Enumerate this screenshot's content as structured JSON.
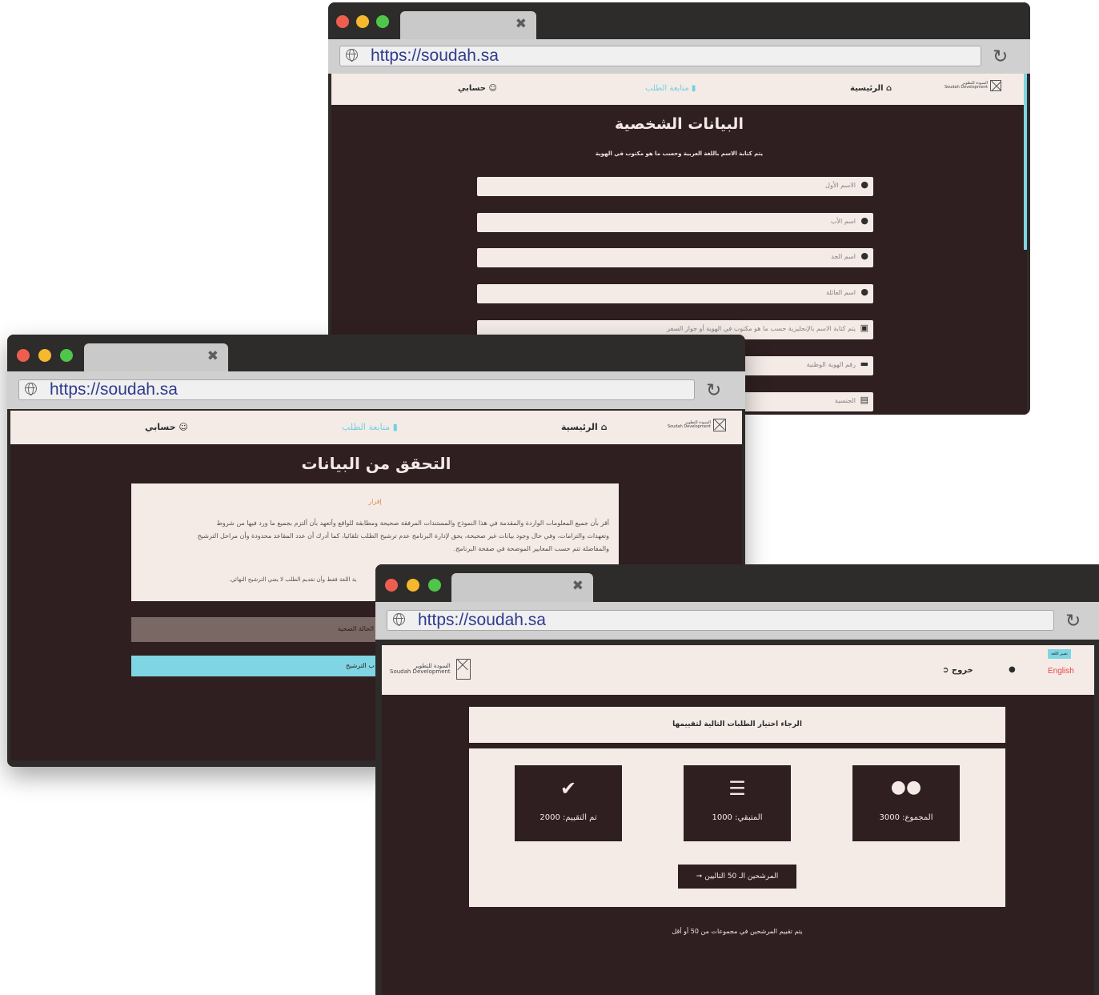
{
  "browser": {
    "url": "https://soudah.sa",
    "tab_close_icon": "✖",
    "reload_icon": "↻"
  },
  "logo": {
    "ar": "السودة للتطوير",
    "en": "Soudah Development"
  },
  "nav": {
    "home": "الرئيسية",
    "track": "متابعة الطلب",
    "account": "حسابي"
  },
  "win1": {
    "title": "البيانات الشخصية",
    "subtitle": "يتم كتابة الاسم باللغة العربية وحسب ما هو مكتوب في الهوية",
    "fields": {
      "first_name": "الاسم الأول",
      "father_name": "اسم الأب",
      "grandfather_name": "اسم الجد",
      "family_name": "اسم العائلة",
      "english_name": "يتم كتابة الاسم بالإنجليزية حسب ما هو مكتوب في الهوية أو جواز السفر",
      "national_id": "رقم الهوية الوطنية",
      "nationality": "الجنسية"
    }
  },
  "win2": {
    "title": "التحقق من البيانات",
    "declaration_heading": "إقرار",
    "declaration_line1": "أقر بأن جميع المعلومات الواردة والمقدمة في هذا النموذج والمستندات المرفقة صحيحة ومطابقة للواقع وأتعهد بأن ألتزم بجميع ما ورد فيها من شروط",
    "declaration_line2": "وتعهدات والتزامات، وفي حال وجود بيانات غير صحيحة، يحق لإدارة البرنامج عدم ترشيح الطلب تلقائيا، كما أدرك أن عدد المقاعد محدودة وأن مراحل الترشيح",
    "declaration_line3": "والمفاضلة تتم حسب المعايير الموضحة في صفحة البرنامج.",
    "note": "ية اللغة فقط وأن تقديم الطلب لا يعني الترشيح النهائي.",
    "health_button": "الحالة الصحية",
    "submit_button": "ب الترشيح"
  },
  "win3": {
    "change_language": "تغيير اللغة",
    "english": "English",
    "logout": "خروج",
    "instruction": "الرجاء اختيار الطلبات التالية لتقييمها",
    "stats": {
      "total": "المجموع: 3000",
      "remaining": "المتبقي: 1000",
      "evaluated": "تم التقييم: 2000"
    },
    "next_button": "المرشحين الـ 50 التاليين",
    "footer_note": "يتم تقييم المرشحين في مجموعات من 50 أو أقل"
  },
  "colors": {
    "frame": "#2e2b2b",
    "content_bg": "#2f1f20",
    "nav_bg": "#f4ebe7",
    "accent_cyan": "#7fd5e3",
    "heading_orange": "#d98b47",
    "english_red": "#e84545",
    "health_btn": "#7a6865"
  }
}
